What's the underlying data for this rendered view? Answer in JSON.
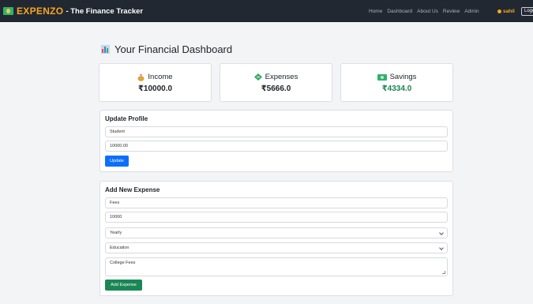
{
  "navbar": {
    "brand": "EXPENZO",
    "tagline": "- The Finance Tracker",
    "links": [
      "Home",
      "Dashboard",
      "About Us",
      "Review",
      "Admin"
    ],
    "user": "sahil",
    "logout": "Logout"
  },
  "dashboard": {
    "title": "Your Financial Dashboard",
    "income": {
      "label": "Income",
      "value": "₹10000.0"
    },
    "expenses": {
      "label": "Expenses",
      "value": "₹5666.0"
    },
    "savings": {
      "label": "Savings",
      "value": "₹4334.0"
    }
  },
  "profile": {
    "title": "Update Profile",
    "occupation": "Student",
    "income": "10000.00",
    "button": "Update"
  },
  "expense_form": {
    "title": "Add New Expense",
    "name": "Fees",
    "amount": "10000",
    "frequency": "Yearly",
    "category": "Education",
    "description": "College Fees",
    "button": "Add Expense"
  },
  "colors": {
    "navbar_bg": "#222831",
    "brand": "#f5a623",
    "savings_value": "#198754",
    "primary_button": "#0d6efd",
    "success_button": "#198754"
  }
}
